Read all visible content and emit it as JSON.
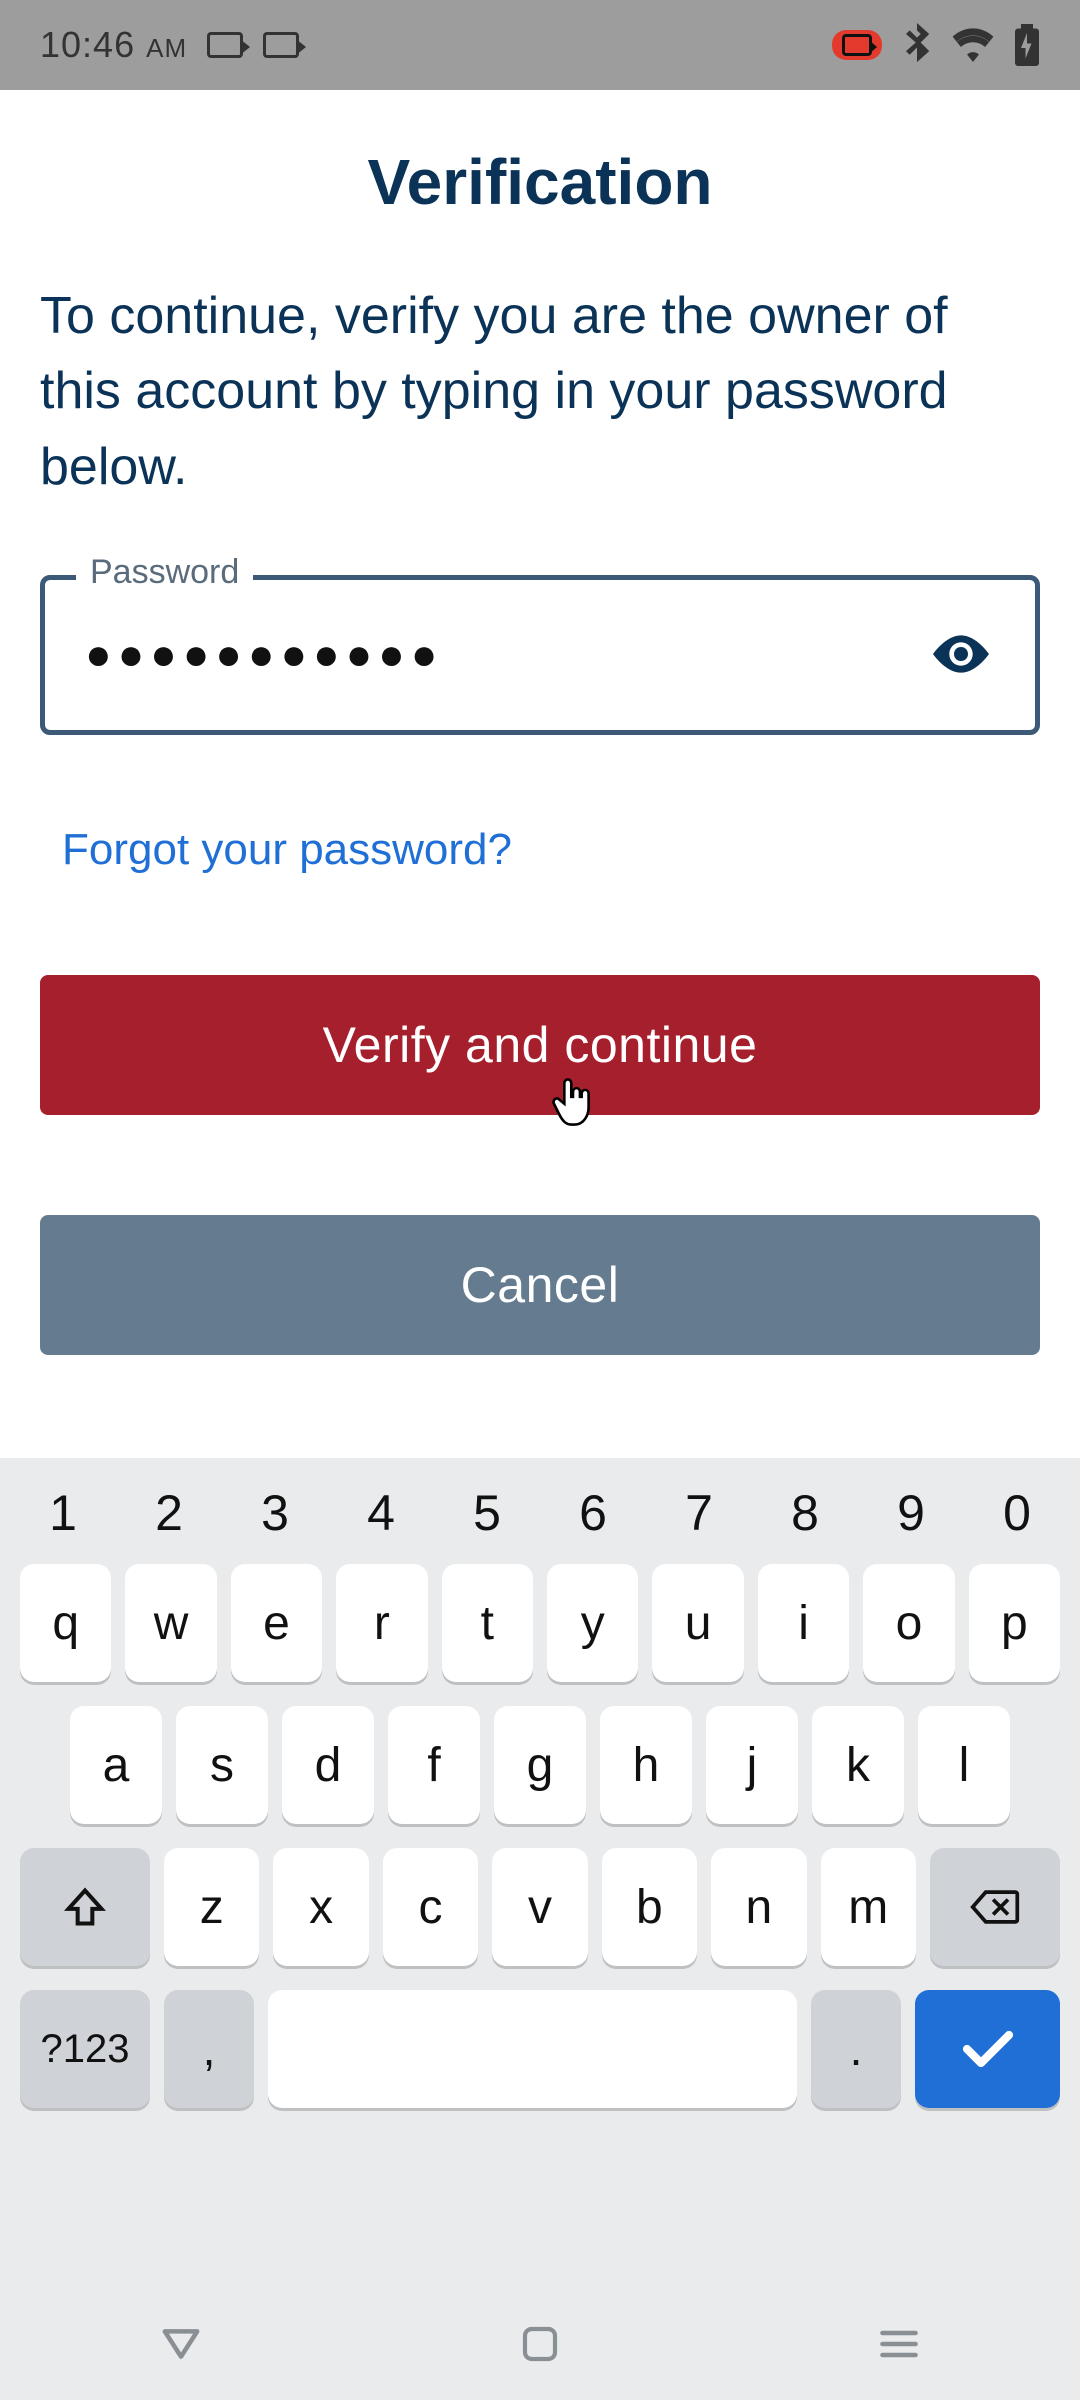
{
  "status_bar": {
    "time": "10:46",
    "ampm": "AM",
    "icons": {
      "camera1": "camera-icon",
      "camera2": "camera-icon",
      "recording": "recording-icon",
      "bluetooth": "bluetooth-icon",
      "wifi": "wifi-icon",
      "battery": "battery-charging-icon"
    }
  },
  "page": {
    "title": "Verification",
    "subtitle": "To continue, verify you are the owner of this account by typing in your password below.",
    "password_label": "Password",
    "password_masked_value": "●●●●●●●●●●●",
    "toggle_visibility_icon": "eye-icon",
    "forgot_link": "Forgot your password?",
    "verify_button": "Verify and continue",
    "cancel_button": "Cancel",
    "cursor_icon": "pointer-cursor-icon"
  },
  "keyboard": {
    "numbers_row": [
      "1",
      "2",
      "3",
      "4",
      "5",
      "6",
      "7",
      "8",
      "9",
      "0"
    ],
    "row1": [
      "q",
      "w",
      "e",
      "r",
      "t",
      "y",
      "u",
      "i",
      "o",
      "p"
    ],
    "row2": [
      "a",
      "s",
      "d",
      "f",
      "g",
      "h",
      "j",
      "k",
      "l"
    ],
    "row3": [
      "z",
      "x",
      "c",
      "v",
      "b",
      "n",
      "m"
    ],
    "shift_icon": "shift-icon",
    "backspace_icon": "backspace-icon",
    "symbols_label": "?123",
    "comma_label": ",",
    "period_label": ".",
    "space_label": "",
    "enter_icon": "check-icon"
  },
  "navbar": {
    "back": "nav-back-icon",
    "home": "nav-home-icon",
    "recent": "nav-recent-icon"
  },
  "colors": {
    "heading": "#0b3357",
    "primary_button": "#a61f2d",
    "secondary_button": "#657c90",
    "link": "#1f6fd6",
    "field_border": "#3c5a78",
    "keyboard_bg": "#e9ebed"
  }
}
